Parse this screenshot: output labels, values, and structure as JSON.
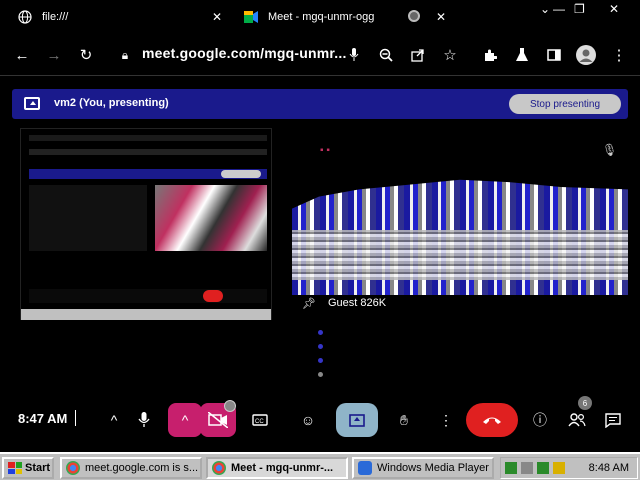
{
  "browser": {
    "tabs": [
      {
        "title": "file:///",
        "icon": "globe-icon"
      },
      {
        "title": "Meet - mgq-unmr-ogg",
        "icon": "meet-icon"
      }
    ],
    "address": "meet.google.com/mgq-unmr..."
  },
  "banner": {
    "text": "vm2 (You, presenting)",
    "stop_label": "Stop presenting",
    "color": "#1a1a8c"
  },
  "guest": {
    "name": "Guest 826K"
  },
  "controls": {
    "time": "8:47 AM",
    "participants_count": "6",
    "hangup_color": "#e02020",
    "accent_color": "#c71f6d"
  },
  "taskbar": {
    "start_label": "Start",
    "tasks": [
      {
        "label": "meet.google.com is s..."
      },
      {
        "label": "Meet - mgq-unmr-..."
      },
      {
        "label": "Windows Media Player"
      }
    ],
    "clock": "8:48 AM"
  }
}
